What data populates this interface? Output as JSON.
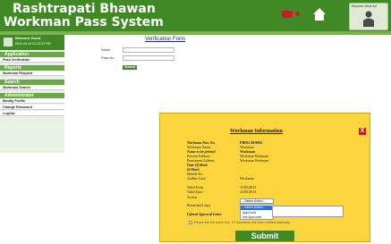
{
  "header": {
    "title_line1": "Rashtrapati Bhawan",
    "title_line2": "Workman Pass System",
    "user_label": "Reporter Work Ad"
  },
  "colors": {
    "header_green": "#3f8a24",
    "sidebar_section": "#6aa945",
    "modal_yellow": "#fbd53b",
    "close_red": "#d31a1a",
    "title_blue": "#1d2a7a"
  },
  "sidebar": {
    "user": {
      "name": "Welcome Guest",
      "datetime": "2011-04-14 21:12:37 PM"
    },
    "sections": [
      {
        "label": "Application",
        "items": [
          "Pass Verification"
        ]
      },
      {
        "label": "Reports",
        "items": [
          "Workman Request"
        ]
      },
      {
        "label": "Search",
        "items": [
          "Workman Search"
        ]
      },
      {
        "label": "Administrator",
        "items": [
          "Modify Profile",
          "Change Password",
          "LogOut"
        ]
      }
    ]
  },
  "verification_form": {
    "title": "Verification Form",
    "name_label": "Name :",
    "pass_no_label": "Pass No :",
    "submit_label": "Submit"
  },
  "modal": {
    "title": "Workman Information",
    "close_label": "X",
    "rows": [
      {
        "label": "Workman Pass No.",
        "value": "PBDG/38/0003",
        "bold": true
      },
      {
        "label": "Workman Name",
        "value": "Workman",
        "bold": false
      },
      {
        "label": "Name to be printed",
        "value": "Workman",
        "bold": true
      },
      {
        "label": "Present Address",
        "value": "Workman Workman",
        "bold": false
      },
      {
        "label": "Permanent Address",
        "value": "Workman Workman",
        "bold": false
      },
      {
        "label": "Date Of Birth",
        "value": "",
        "bold": true
      },
      {
        "label": "Id Mark",
        "value": "",
        "bold": true
      },
      {
        "label": "Mobile No",
        "value": "",
        "bold": false
      },
      {
        "label": "Aadhar Card",
        "value": "Workman",
        "bold": false
      },
      {
        "label": "Valid From",
        "value": "11/05/2013",
        "bold": false
      },
      {
        "label": "Valid Upto",
        "value": "12/05/2013",
        "bold": false
      },
      {
        "label": "Action",
        "value": "",
        "bold": false
      },
      {
        "label": "Remarks(if any)",
        "value": "",
        "bold": false
      },
      {
        "label": "Upload Approval Letter",
        "value": "",
        "bold": true
      }
    ],
    "select_value": "--Select Action--",
    "options": [
      "--Select Action--",
      "Approved",
      "Not Approved"
    ],
    "checkbox_text": "Please tick the check box , If Documents has been verified physically.",
    "submit_label": "Submit"
  }
}
